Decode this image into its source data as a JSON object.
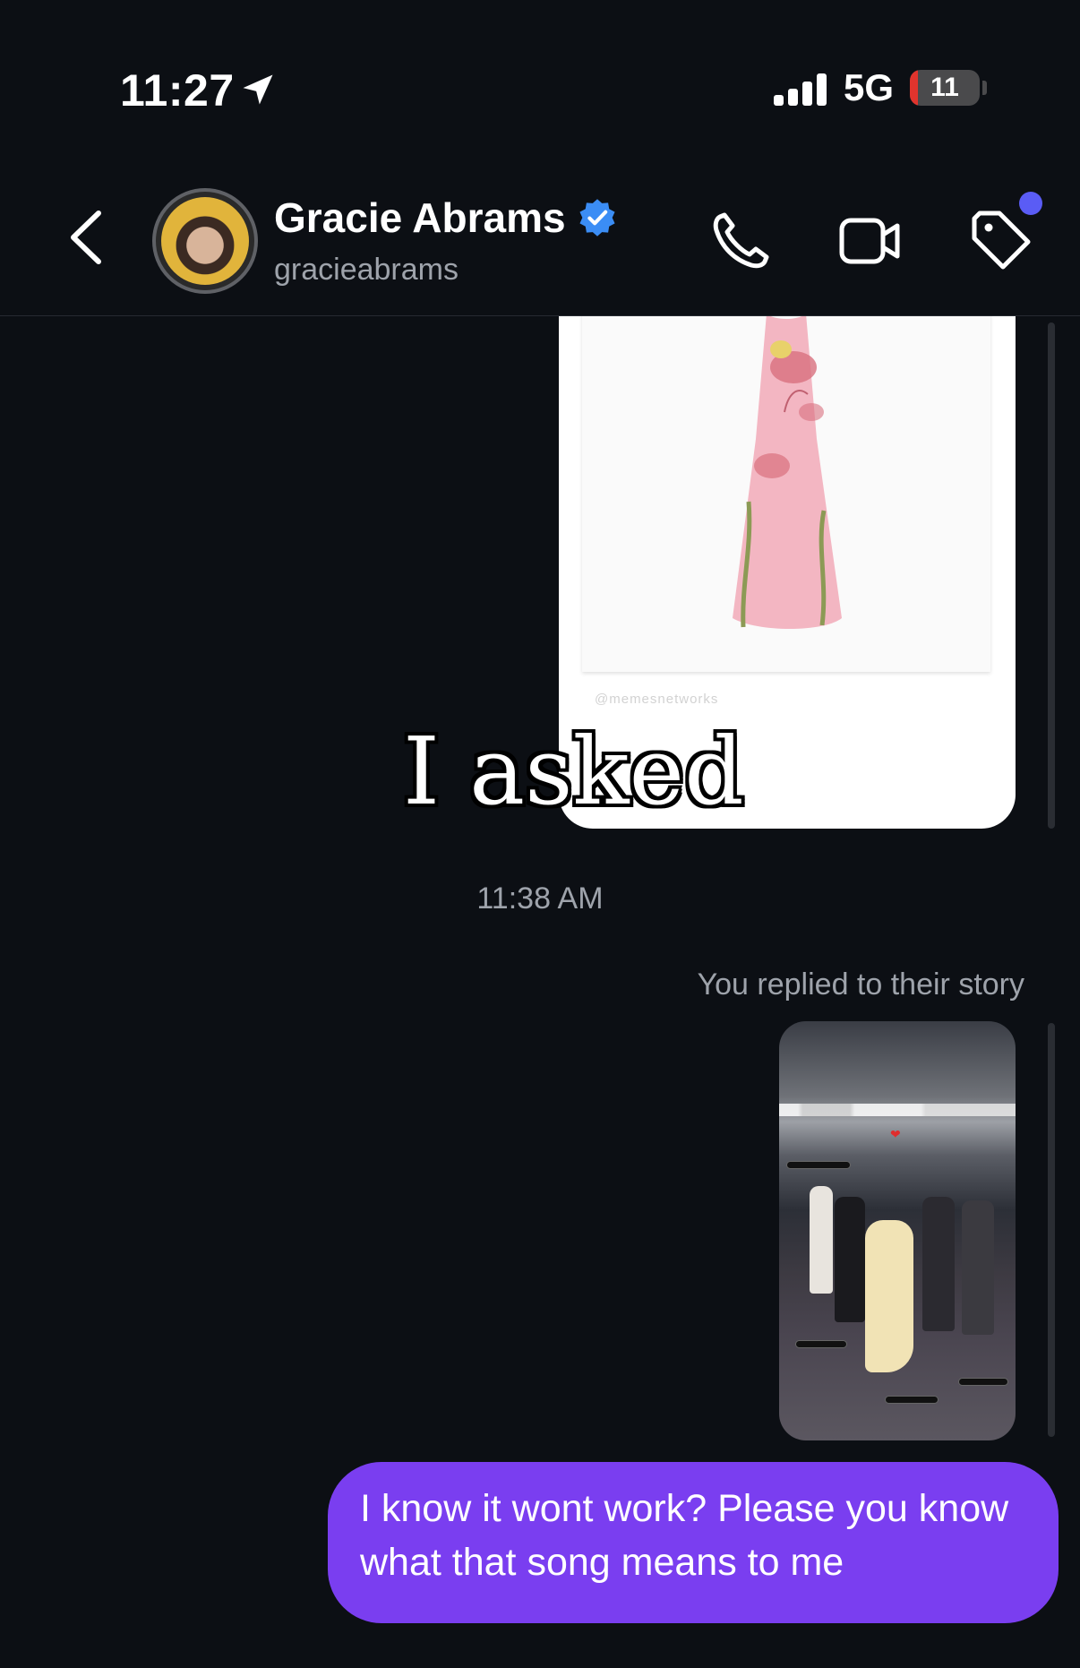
{
  "status_bar": {
    "time": "11:27",
    "network": "5G",
    "battery": "11",
    "battery_level": 11
  },
  "header": {
    "back_icon": "chevron-left-icon",
    "name": "Gracie Abrams",
    "username": "gracieabrams",
    "verified_icon": "verified-badge-icon",
    "actions": [
      "phone-icon",
      "video-camera-icon",
      "tag-icon"
    ],
    "accent": "#5a5cf5"
  },
  "messages": {
    "story_watermark": "@memesnetworks",
    "overlay_text": "I asked",
    "timestamp": "11:38 AM",
    "reply_label": "You replied to their story",
    "outgoing_text": "I know it wont work? Please you know what that song means to me",
    "outgoing_color": "#7a3ef0"
  }
}
